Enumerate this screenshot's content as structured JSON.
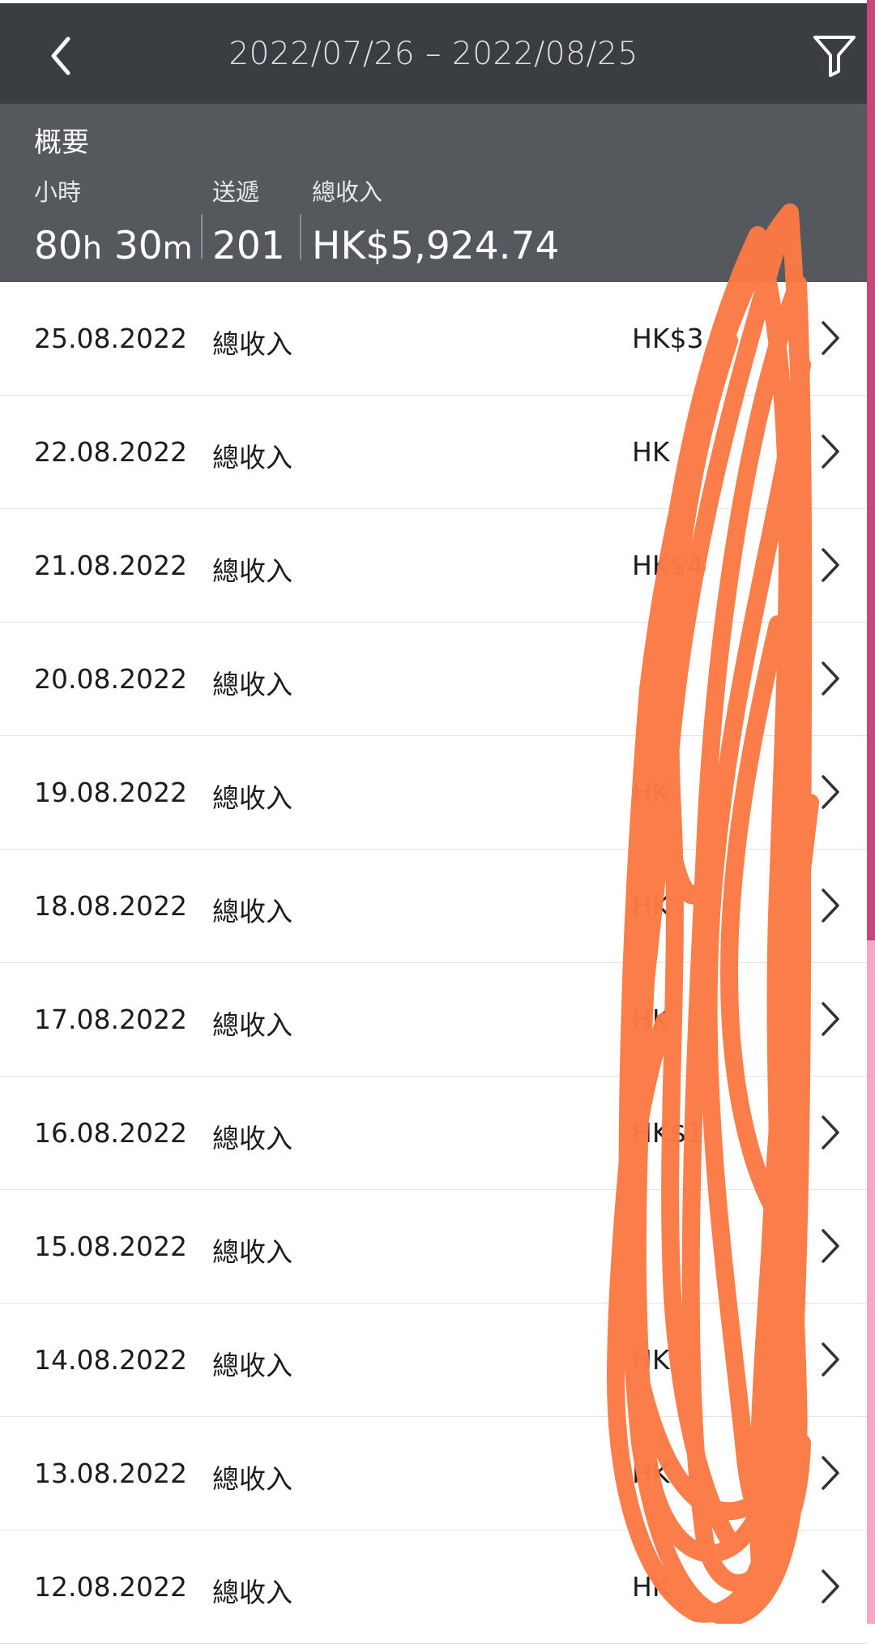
{
  "header": {
    "title": "2022/07/26 – 2022/08/25",
    "back_icon": "chevron-left-icon",
    "filter_icon": "filter-icon"
  },
  "summary": {
    "title": "概要",
    "hours_label": "小時",
    "hours_h": "80",
    "hours_h_unit": "h",
    "hours_m": " 30",
    "hours_m_unit": "m",
    "deliveries_label": "送遞",
    "deliveries_value": "201",
    "income_label": "總收入",
    "income_value": "HK$5,924.74"
  },
  "rows": [
    {
      "date": "25.08.2022",
      "label": "總收入",
      "amount": "HK$3"
    },
    {
      "date": "22.08.2022",
      "label": "總收入",
      "amount": "HK"
    },
    {
      "date": "21.08.2022",
      "label": "總收入",
      "amount": "HK$4"
    },
    {
      "date": "20.08.2022",
      "label": "總收入",
      "amount": ""
    },
    {
      "date": "19.08.2022",
      "label": "總收入",
      "amount": "HK"
    },
    {
      "date": "18.08.2022",
      "label": "總收入",
      "amount": "HK"
    },
    {
      "date": "17.08.2022",
      "label": "總收入",
      "amount": "HK"
    },
    {
      "date": "16.08.2022",
      "label": "總收入",
      "amount": "HK$1"
    },
    {
      "date": "15.08.2022",
      "label": "總收入",
      "amount": ""
    },
    {
      "date": "14.08.2022",
      "label": "總收入",
      "amount": "HK"
    },
    {
      "date": "13.08.2022",
      "label": "總收入",
      "amount": "HK"
    },
    {
      "date": "12.08.2022",
      "label": "總收入",
      "amount": "HK"
    }
  ],
  "colors": {
    "header_bg": "#3a3d42",
    "summary_bg": "#55585d",
    "scribble": "#fb7a45",
    "scrollbar": "#c4487a"
  }
}
